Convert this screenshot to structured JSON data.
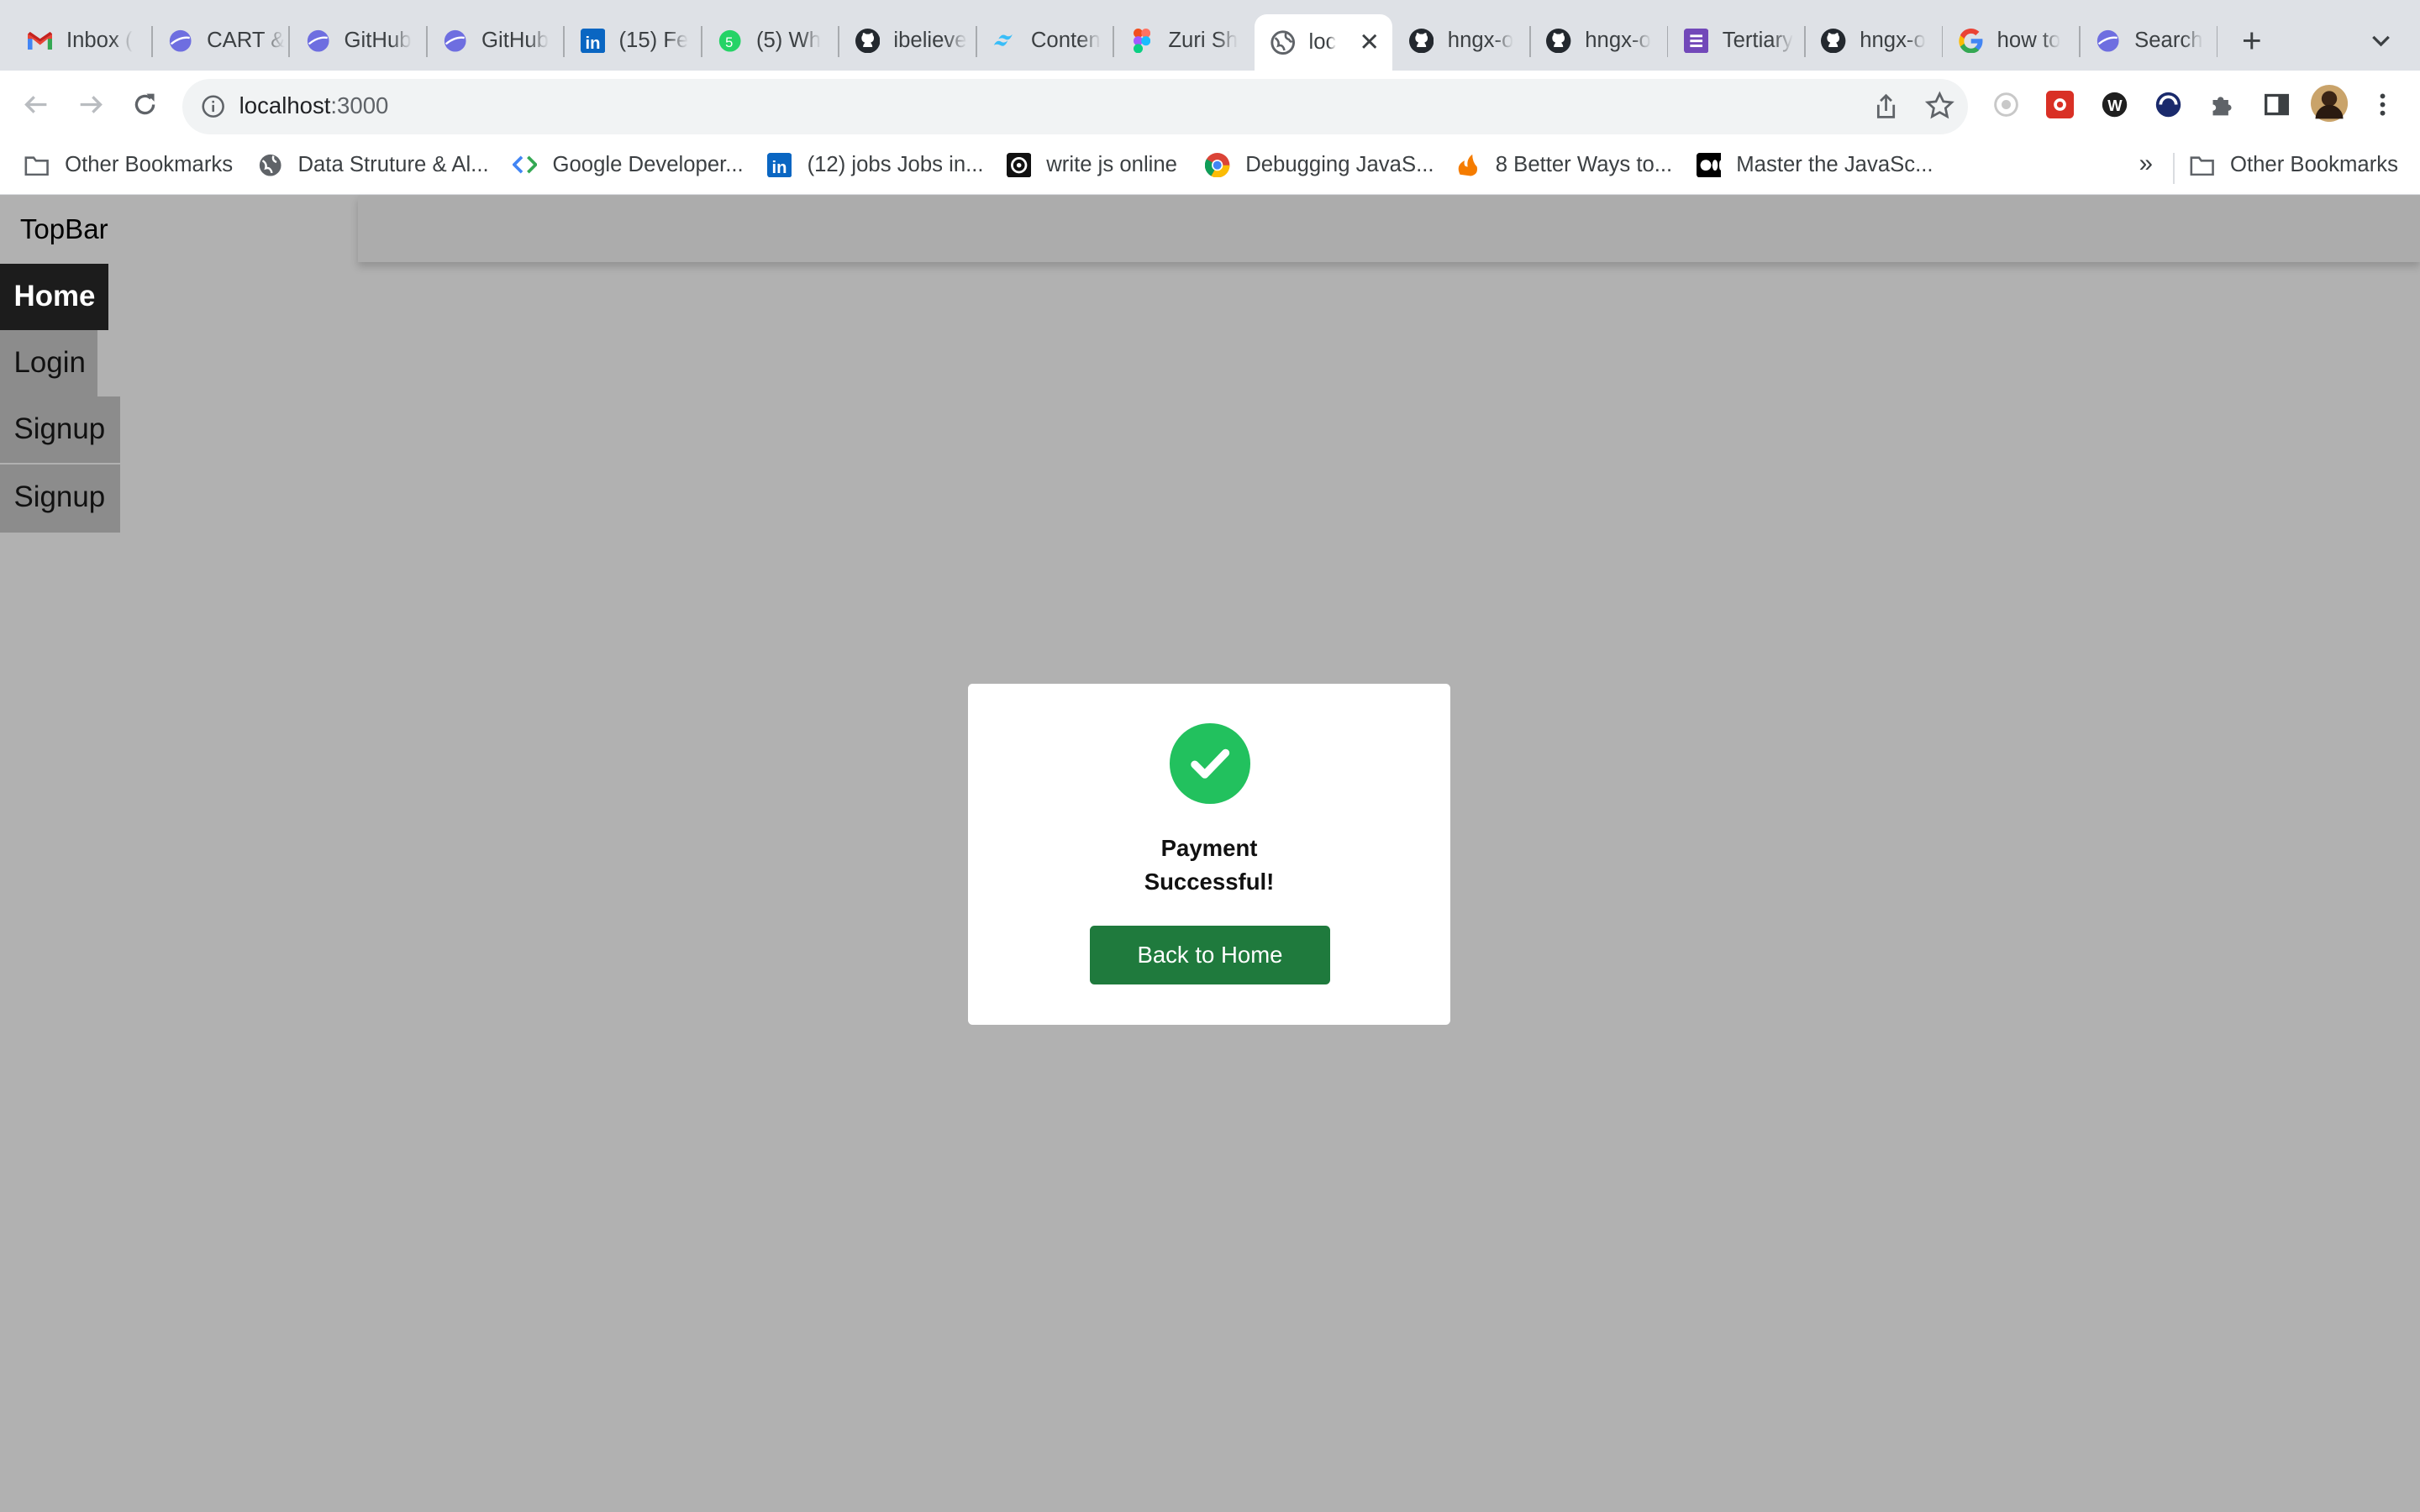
{
  "browser": {
    "tabs": [
      {
        "title": "Inbox (",
        "icon": "gmail-icon"
      },
      {
        "title": "CART &",
        "icon": "planet-icon"
      },
      {
        "title": "GitHub",
        "icon": "planet-icon"
      },
      {
        "title": "GitHub",
        "icon": "planet-icon"
      },
      {
        "title": "(15) Fe",
        "icon": "linkedin-icon"
      },
      {
        "title": "(5) Wh",
        "icon": "whatsapp-icon"
      },
      {
        "title": "ibelieve",
        "icon": "github-icon"
      },
      {
        "title": "Conten",
        "icon": "tailwind-icon"
      },
      {
        "title": "Zuri Sh",
        "icon": "figma-icon"
      },
      {
        "title": "loc",
        "icon": "globe-icon",
        "active": true
      },
      {
        "title": "hngx-o",
        "icon": "github-icon"
      },
      {
        "title": "hngx-o",
        "icon": "github-icon"
      },
      {
        "title": "Tertiary",
        "icon": "forms-icon"
      },
      {
        "title": "hngx-o",
        "icon": "github-icon"
      },
      {
        "title": "how to",
        "icon": "google-icon"
      },
      {
        "title": "Search",
        "icon": "planet-icon"
      }
    ],
    "url_host": "localhost",
    "url_port": ":3000",
    "bookmarks": [
      {
        "label": "Other Bookmarks",
        "icon": "folder-icon"
      },
      {
        "label": "Data Struture & Al...",
        "icon": "globe-icon"
      },
      {
        "label": "Google Developer...",
        "icon": "google-dev-icon"
      },
      {
        "label": "(12) jobs Jobs in...",
        "icon": "linkedin-icon"
      },
      {
        "label": "write js online",
        "icon": "spiral-icon"
      },
      {
        "label": "Debugging JavaS...",
        "icon": "chrome-icon"
      },
      {
        "label": "8 Better Ways to...",
        "icon": "fire-icon"
      },
      {
        "label": "Master the JavaSc...",
        "icon": "medium-icon"
      }
    ],
    "bookmarks_overflow": "»",
    "other_bookmarks": "Other Bookmarks"
  },
  "page": {
    "topbar_label": "TopBar",
    "nav": {
      "home": "Home",
      "login": "Login",
      "signup_1": "Signup",
      "signup_2": "Signup"
    },
    "modal": {
      "message_line1": "Payment",
      "message_line2": "Successful!",
      "button_label": "Back to Home"
    }
  },
  "colors": {
    "overlay": "#b1b1b1",
    "success_green": "#22c15e",
    "button_green": "#1f7a3d"
  }
}
